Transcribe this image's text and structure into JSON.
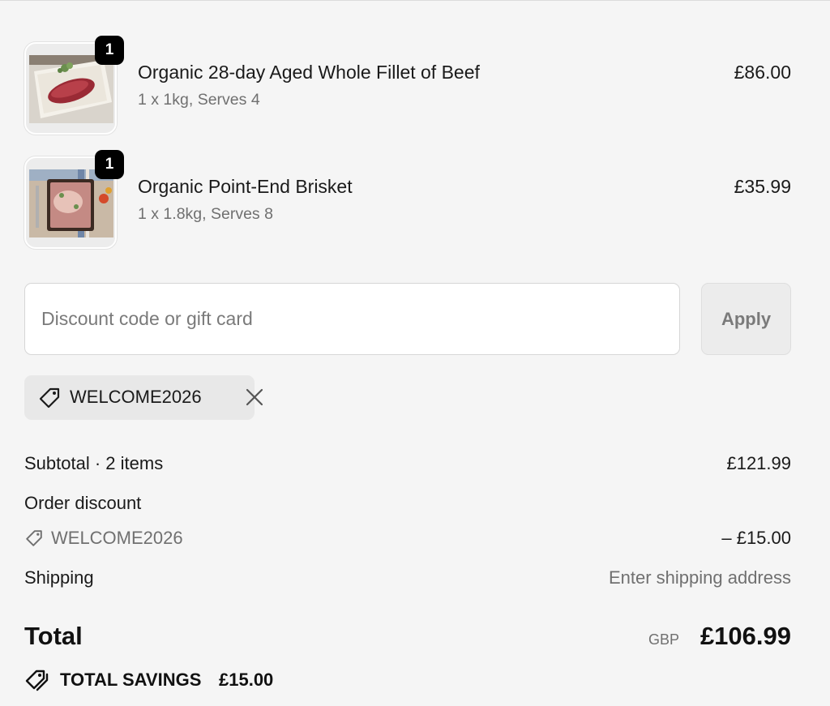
{
  "items": [
    {
      "image": "beef-fillet-photo",
      "quantity_badge": "1",
      "title": "Organic 28-day Aged Whole Fillet of Beef",
      "subtitle": "1 x 1kg, Serves 4",
      "price": "£86.00"
    },
    {
      "image": "brisket-photo",
      "quantity_badge": "1",
      "title": "Organic Point-End Brisket",
      "subtitle": "1 x 1.8kg, Serves 8",
      "price": "£35.99"
    }
  ],
  "discount": {
    "placeholder": "Discount code or gift card",
    "value": "",
    "apply_label": "Apply",
    "applied_code": "WELCOME2026",
    "chip_icon": "tag-icon",
    "remove_icon": "close-icon"
  },
  "summary": {
    "subtotal_label": "Subtotal · 2 items",
    "subtotal_value": "£121.99",
    "order_discount_label": "Order discount",
    "order_discount_code": "WELCOME2026",
    "order_discount_value": "– £15.00",
    "shipping_label": "Shipping",
    "shipping_value": "Enter shipping address",
    "total_label": "Total",
    "currency": "GBP",
    "total_value": "£106.99",
    "savings_label": "TOTAL SAVINGS",
    "savings_value": "£15.00"
  },
  "colors": {
    "background": "#f5f5f5",
    "badge": "#000000",
    "muted_text": "#707070"
  }
}
